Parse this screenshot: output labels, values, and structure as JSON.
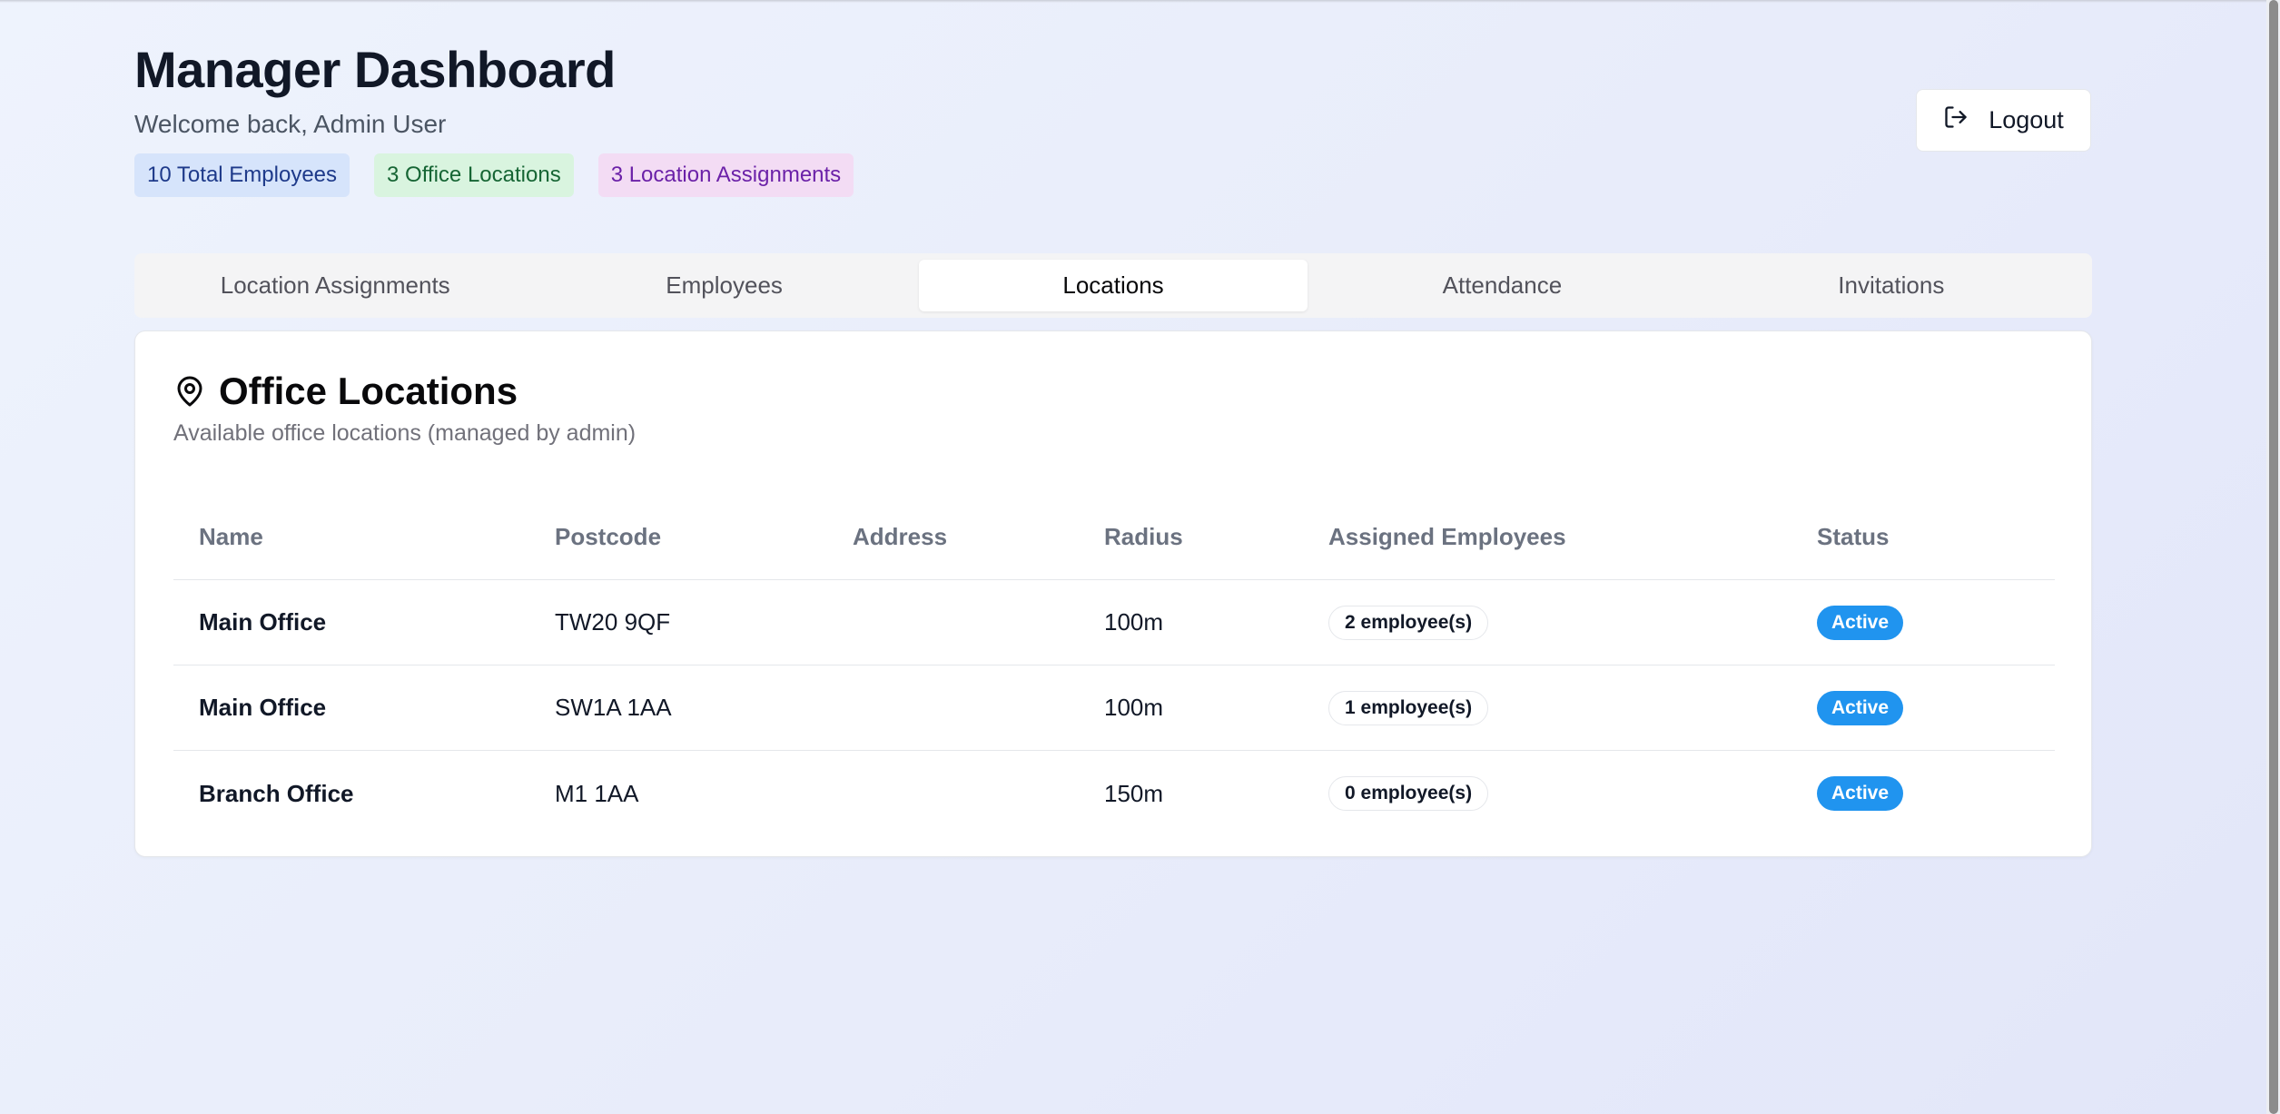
{
  "header": {
    "title": "Manager Dashboard",
    "welcome": "Welcome back, Admin User",
    "badges": [
      {
        "label": "10 Total Employees",
        "color": "#d6e4fb"
      },
      {
        "label": "3 Office Locations",
        "color": "#d9f4df"
      },
      {
        "label": "3 Location Assignments",
        "color": "#f3dcf4"
      }
    ],
    "logout_label": "Logout",
    "logout_icon": "logout-icon"
  },
  "tabs": [
    {
      "label": "Location Assignments",
      "active": false
    },
    {
      "label": "Employees",
      "active": false
    },
    {
      "label": "Locations",
      "active": true
    },
    {
      "label": "Attendance",
      "active": false
    },
    {
      "label": "Invitations",
      "active": false
    }
  ],
  "card": {
    "icon": "map-pin-icon",
    "title": "Office Locations",
    "subtitle": "Available office locations (managed by admin)",
    "columns": [
      "Name",
      "Postcode",
      "Address",
      "Radius",
      "Assigned Employees",
      "Status"
    ],
    "rows": [
      {
        "name": "Main Office",
        "postcode": "TW20 9QF",
        "address": "",
        "radius": "100m",
        "assigned": "2 employee(s)",
        "status": "Active"
      },
      {
        "name": "Main Office",
        "postcode": "SW1A 1AA",
        "address": "",
        "radius": "100m",
        "assigned": "1 employee(s)",
        "status": "Active"
      },
      {
        "name": "Branch Office",
        "postcode": "M1 1AA",
        "address": "",
        "radius": "150m",
        "assigned": "0 employee(s)",
        "status": "Active"
      }
    ],
    "status_color": "#2094ef"
  }
}
